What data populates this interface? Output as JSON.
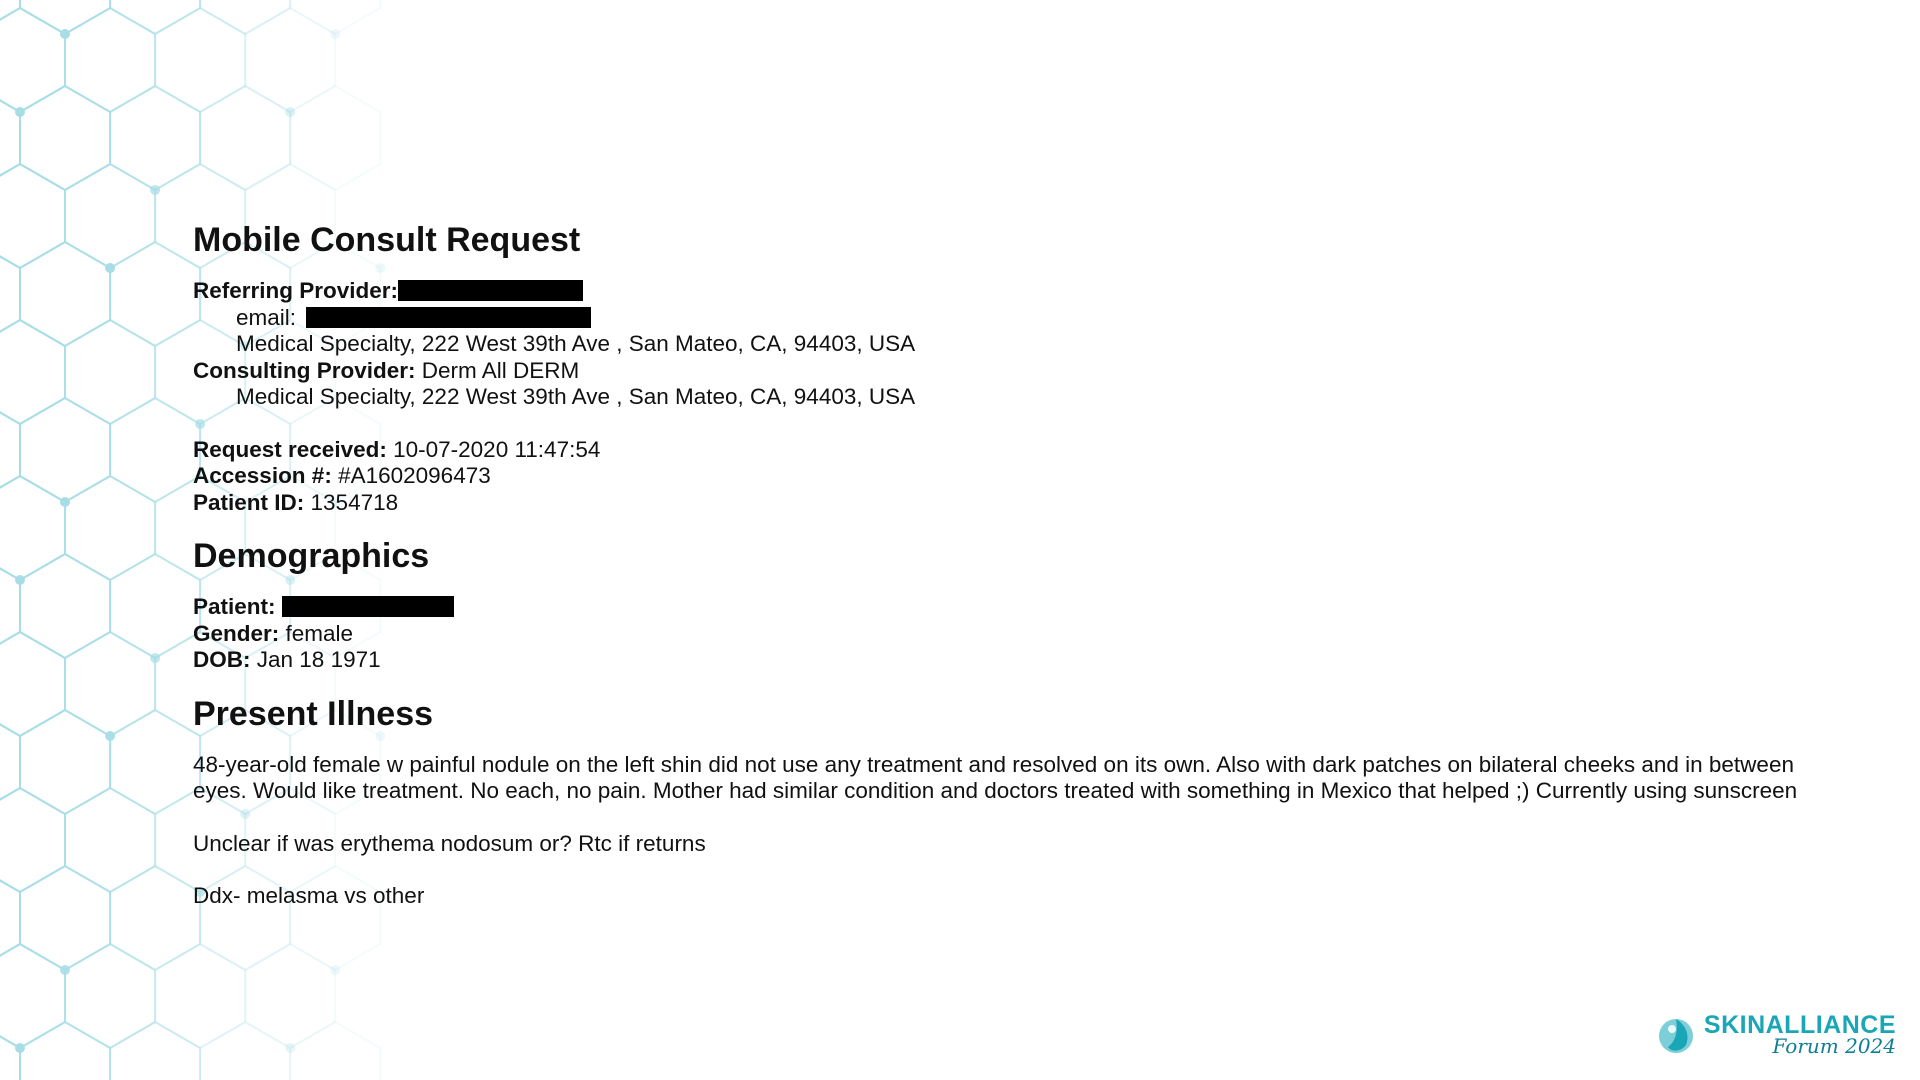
{
  "document": {
    "title": "Mobile Consult Request",
    "referring": {
      "label": "Referring Provider:",
      "email_label": "email:",
      "address": "Medical Specialty, 222 West 39th Ave , San Mateo, CA, 94403, USA"
    },
    "consulting": {
      "label": "Consulting Provider:",
      "value": "Derm All DERM",
      "address": "Medical Specialty, 222 West 39th Ave , San Mateo, CA, 94403, USA"
    },
    "request_received": {
      "label": "Request received:",
      "value": "10-07-2020 11:47:54"
    },
    "accession": {
      "label": "Accession #:",
      "value": "#A1602096473"
    },
    "patient_id": {
      "label": "Patient ID:",
      "value": "1354718"
    }
  },
  "demographics": {
    "heading": "Demographics",
    "patient_label": "Patient:",
    "gender": {
      "label": "Gender:",
      "value": "female"
    },
    "dob": {
      "label": "DOB:",
      "value": "Jan 18 1971"
    }
  },
  "present_illness": {
    "heading": "Present Illness",
    "paragraphs": [
      "48-year-old female w painful nodule on the left shin did not use any treatment and resolved on its own. Also with dark patches on bilateral cheeks and in between eyes. Would like treatment. No each, no pain. Mother had similar condition and doctors treated with something in Mexico that helped ;) Currently using sunscreen",
      "Unclear if was erythema nodosum or? Rtc if returns",
      "Ddx- melasma vs other"
    ]
  },
  "logo": {
    "name": "SKINALLIANCE",
    "sub": "Forum 2024",
    "icon": "leaf-drop-icon"
  },
  "colors": {
    "text": "#111111",
    "redaction": "#000000",
    "hex_pattern": "#a8dde6",
    "logo_teal": "#1aa6b7",
    "logo_dark": "#0e7f93"
  }
}
